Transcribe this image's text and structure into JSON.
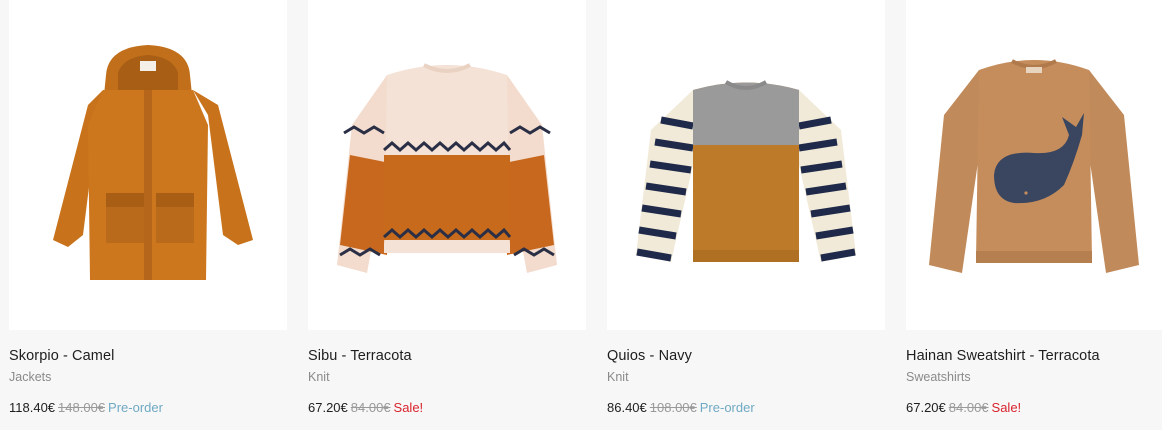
{
  "products": [
    {
      "name": "Skorpio - Camel",
      "category": "Jackets",
      "price": "118.40€",
      "old_price": "148.00€",
      "tag": "Pre-order",
      "tag_color": "#6fa9c4",
      "image_icon": "camel-hooded-jacket"
    },
    {
      "name": "Sibu - Terracota",
      "category": "Knit",
      "price": "67.20€",
      "old_price": "84.00€",
      "tag": "Sale!",
      "tag_color": "#d9232d",
      "image_icon": "zigzag-knit-sweater"
    },
    {
      "name": "Quios - Navy",
      "category": "Knit",
      "price": "86.40€",
      "old_price": "108.00€",
      "tag": "Pre-order",
      "tag_color": "#6fa9c4",
      "image_icon": "striped-sleeve-sweater"
    },
    {
      "name": "Hainan Sweatshirt - Terracota",
      "category": "Sweatshirts",
      "price": "67.20€",
      "old_price": "84.00€",
      "tag": "Sale!",
      "tag_color": "#d9232d",
      "image_icon": "whale-print-sweatshirt"
    }
  ]
}
